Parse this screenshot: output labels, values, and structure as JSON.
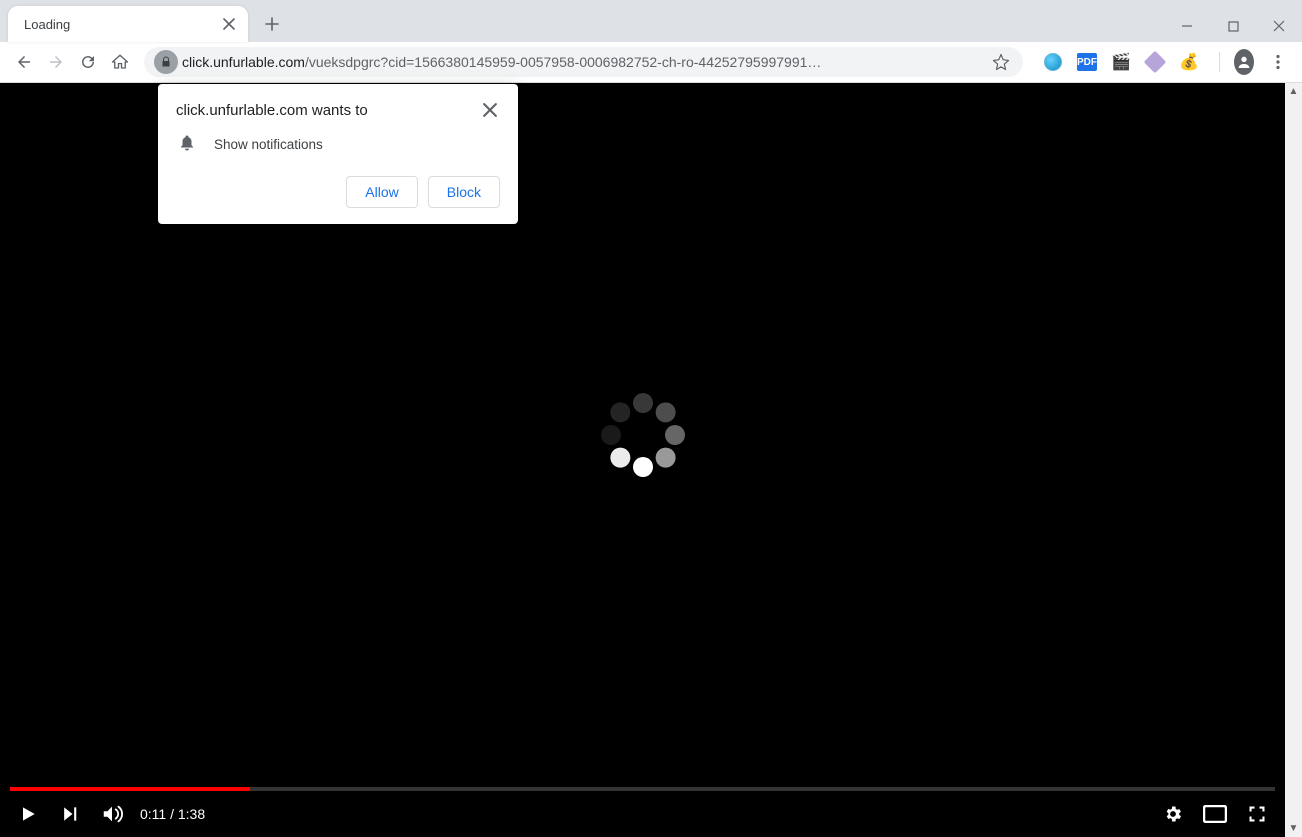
{
  "tab": {
    "title": "Loading"
  },
  "url": {
    "host": "click.unfurlable.com",
    "path": "/vueksdpgrc?cid=1566380145959-0057958-0006982752-ch-ro-44252795997991…"
  },
  "extensions": {
    "pdf_label": "PDF",
    "moneybag": "💰",
    "clapper": "🎬"
  },
  "video": {
    "current_time": "0:11",
    "duration": "1:38",
    "time_display": "0:11 / 1:38",
    "progress_pct": 19
  },
  "permission_popup": {
    "origin_wants_to": "click.unfurlable.com wants to",
    "item_label": "Show notifications",
    "allow_label": "Allow",
    "block_label": "Block"
  }
}
